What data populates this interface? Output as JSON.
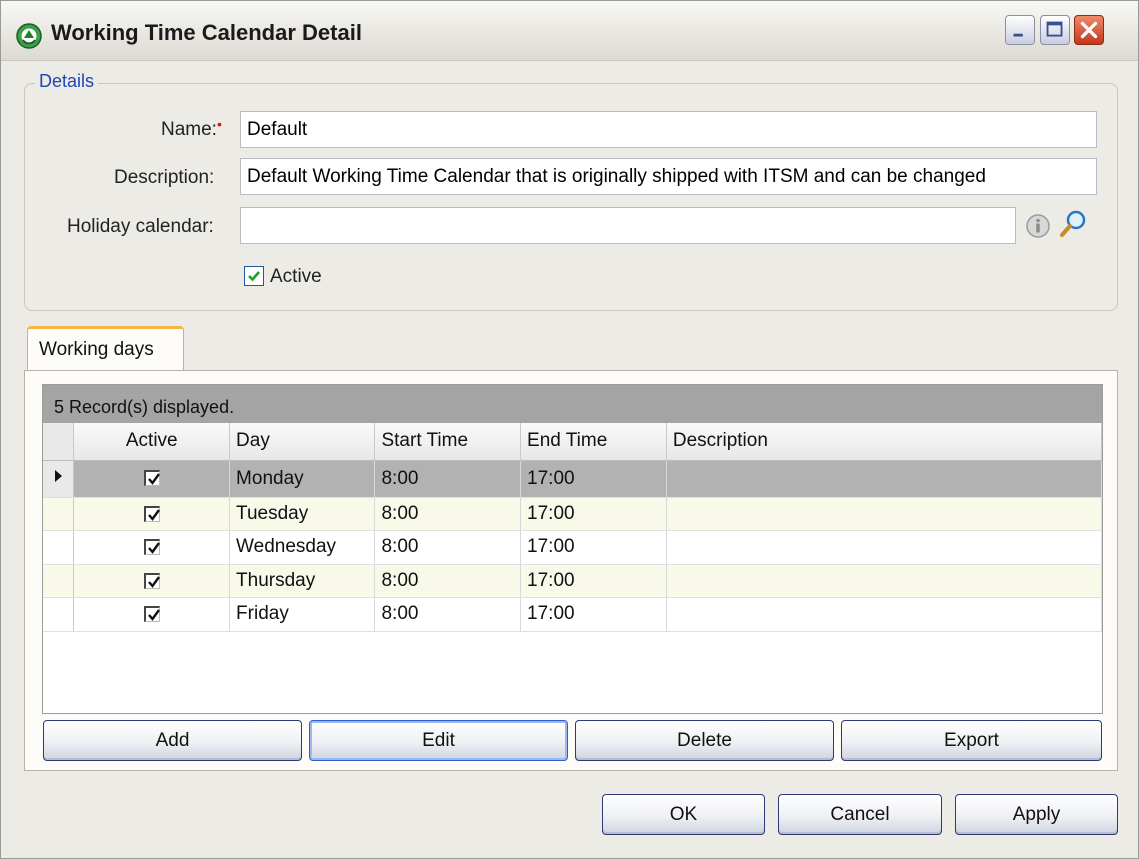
{
  "window": {
    "title": "Working Time Calendar Detail",
    "icon": "itsm-app-icon",
    "controls": [
      "minimize-icon",
      "maximize-icon",
      "close-icon"
    ]
  },
  "details": {
    "legend": "Details",
    "name_label": "Name:",
    "name_required_mark": "•",
    "name_value": "Default",
    "description_label": "Description:",
    "description_value": "Default Working Time Calendar that is originally shipped with ITSM and can be changed",
    "holiday_label": "Holiday calendar:",
    "holiday_value": "",
    "holiday_icons": [
      "info-icon",
      "search-icon"
    ],
    "active_label": "Active",
    "active_checked": true
  },
  "tabs": [
    {
      "label": "Working days",
      "selected": true
    }
  ],
  "grid": {
    "caption": "5 Record(s) displayed.",
    "columns": [
      "Active",
      "Day",
      "Start Time",
      "End Time",
      "Description"
    ],
    "rows": [
      {
        "active": true,
        "day": "Monday",
        "start": "8:00",
        "end": "17:00",
        "description": "",
        "current": true
      },
      {
        "active": true,
        "day": "Tuesday",
        "start": "8:00",
        "end": "17:00",
        "description": ""
      },
      {
        "active": true,
        "day": "Wednesday",
        "start": "8:00",
        "end": "17:00",
        "description": ""
      },
      {
        "active": true,
        "day": "Thursday",
        "start": "8:00",
        "end": "17:00",
        "description": ""
      },
      {
        "active": true,
        "day": "Friday",
        "start": "8:00",
        "end": "17:00",
        "description": ""
      }
    ]
  },
  "grid_buttons": {
    "add": "Add",
    "edit": "Edit",
    "delete": "Delete",
    "export": "Export"
  },
  "dialog_buttons": {
    "ok": "OK",
    "cancel": "Cancel",
    "apply": "Apply"
  },
  "colors": {
    "legend_blue": "#1f47b3",
    "tab_accent": "#f4b63f",
    "required_red": "#d11111",
    "alt_row": "#f8f9e8",
    "current_row": "#b2b2b2"
  }
}
